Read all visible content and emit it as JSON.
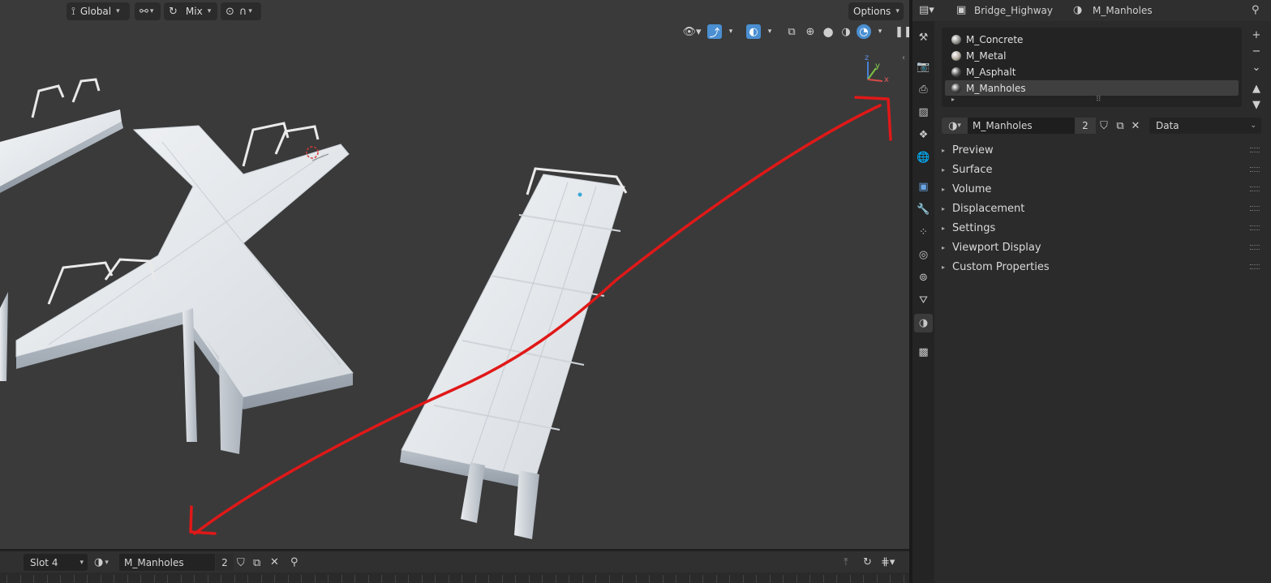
{
  "viewport_header": {
    "orientation": "Global",
    "snap_mode": "Mix",
    "options_label": "Options"
  },
  "gizmo": {
    "z": "z",
    "y": "y",
    "x": "x"
  },
  "bottom_bar": {
    "slot": "Slot 4",
    "material": "M_Manholes",
    "users": "2"
  },
  "properties": {
    "breadcrumb_object": "Bridge_Highway",
    "breadcrumb_material": "M_Manholes",
    "slots": [
      {
        "name": "M_Concrete",
        "color": "#8a8a86"
      },
      {
        "name": "M_Metal",
        "color": "#b0a89c"
      },
      {
        "name": "M_Asphalt",
        "color": "#4a4a4a"
      },
      {
        "name": "M_Manholes",
        "color": "#3f3f3f"
      }
    ],
    "material_name": "M_Manholes",
    "users": "2",
    "link": "Data",
    "panels": [
      "Preview",
      "Surface",
      "Volume",
      "Displacement",
      "Settings",
      "Viewport Display",
      "Custom Properties"
    ]
  },
  "colors": {
    "accent_blue": "#4a8fd1",
    "annotation_red": "#e01818",
    "viewport_bg": "#3a3a3a"
  }
}
